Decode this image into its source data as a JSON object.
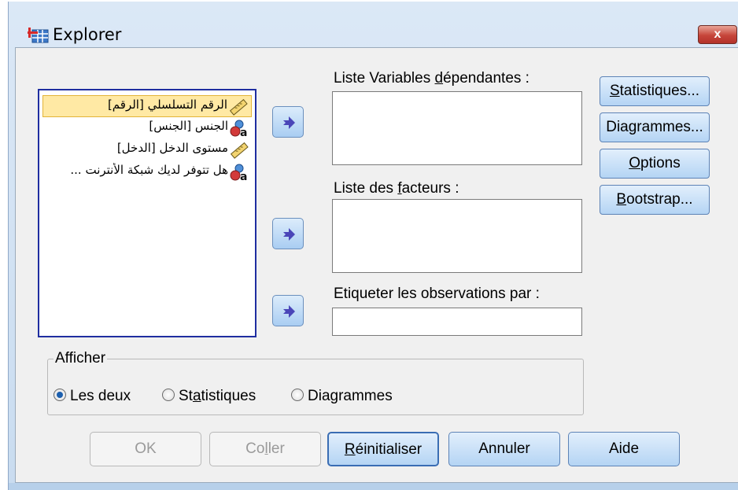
{
  "window": {
    "title": "Explorer",
    "close_label": "x"
  },
  "variables": [
    {
      "label": "الرقم التسلسلي [الرقم]",
      "icon": "ruler-scale-icon",
      "selected": true
    },
    {
      "label": "الجنس [الجنس]",
      "icon": "nominal-variable-icon",
      "selected": false
    },
    {
      "label": "مستوى الدخل [الدخل]",
      "icon": "ruler-scale-icon",
      "selected": false
    },
    {
      "label": "هل تتوفر لديك شبكة الأنترنت ...",
      "icon": "nominal-variable-icon",
      "selected": false
    }
  ],
  "dependent": {
    "pre": "Liste Variables ",
    "key": "d",
    "post": "épendantes :"
  },
  "factors": {
    "pre": "Liste des ",
    "key": "f",
    "post": "acteurs :"
  },
  "label_cases": {
    "text": "Etiqueter les observations par :"
  },
  "side_buttons": {
    "statistics": {
      "key": "S",
      "rest": "tatistiques..."
    },
    "plots": {
      "text": "Diagrammes..."
    },
    "options": {
      "key": "O",
      "rest": "ptions"
    },
    "bootstrap": {
      "key": "B",
      "rest": "ootstrap..."
    }
  },
  "display": {
    "title": "Afficher",
    "both": "Les deux",
    "statistics": {
      "pre": "St",
      "key": "a",
      "post": "tistiques"
    },
    "plots": "Diagrammes",
    "selected": "both"
  },
  "buttons": {
    "ok": "OK",
    "paste": {
      "pre": "Co",
      "key": "l",
      "post": "ler"
    },
    "reset": {
      "key": "R",
      "rest": "éinitialiser"
    },
    "cancel": "Annuler",
    "help": "Aide"
  },
  "colors": {
    "selection": "#ffe9a4",
    "list_border": "#1f2ea0",
    "button_top": "#e2effc",
    "button_bottom": "#b4d4f4",
    "close_red": "#c6453a"
  }
}
